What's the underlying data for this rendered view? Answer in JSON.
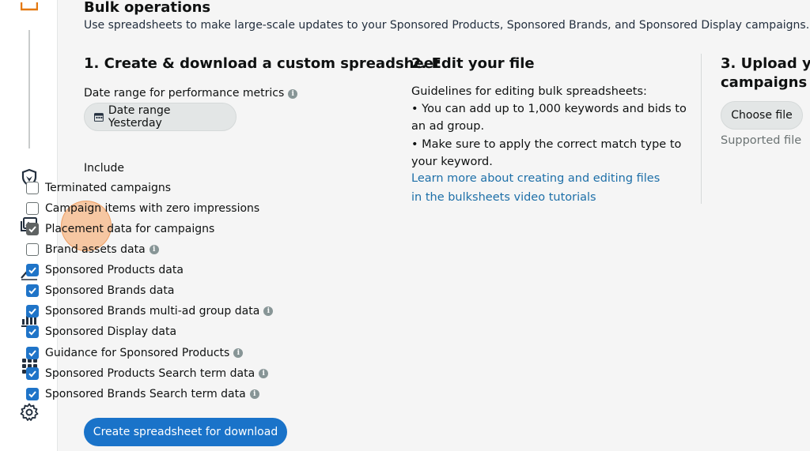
{
  "header": {
    "title": "Bulk operations",
    "subtitle": "Use spreadsheets to make large-scale updates to your Sponsored Products, Sponsored Brands, and Sponsored Display campaigns."
  },
  "step1": {
    "heading": "1. Create & download a custom spreadsheet",
    "date_label": "Date range for performance metrics",
    "date_button": "Date range Yesterday",
    "include_label": "Include",
    "options": [
      {
        "label": "Terminated campaigns",
        "checked": false,
        "info": false
      },
      {
        "label": "Campaign items with zero impressions",
        "checked": false,
        "info": false
      },
      {
        "label": "Placement data for campaigns",
        "checked": true,
        "info": false
      },
      {
        "label": "Brand assets data",
        "checked": false,
        "info": true
      },
      {
        "label": "Sponsored Products data",
        "checked": true,
        "info": false
      },
      {
        "label": "Sponsored Brands data",
        "checked": true,
        "info": false
      },
      {
        "label": "Sponsored Brands multi-ad group data",
        "checked": true,
        "info": true
      },
      {
        "label": "Sponsored Display data",
        "checked": true,
        "info": false
      },
      {
        "label": "Guidance for Sponsored Products",
        "checked": true,
        "info": true
      },
      {
        "label": "Sponsored Products Search term data",
        "checked": true,
        "info": true
      },
      {
        "label": "Sponsored Brands Search term data",
        "checked": true,
        "info": true
      }
    ],
    "create_button": "Create spreadsheet for download"
  },
  "step2": {
    "heading": "2. Edit your file",
    "guidelines_title": "Guidelines for editing bulk spreadsheets:",
    "bullet1_line1": "• You can add up to 1,000 keywords and bids to",
    "bullet1_line2": "an ad group.",
    "bullet2_line1": "• Make sure to apply the correct match type to",
    "bullet2_line2": "your keyword.",
    "link_line1": "Learn more about creating and editing files",
    "link_line2": "in the bulksheets video tutorials"
  },
  "step3": {
    "heading_line1": "3. Upload yo",
    "heading_line2": "campaigns",
    "choose_button": "Choose file",
    "supported": "Supported file"
  },
  "colors": {
    "accent": "#1a73c9",
    "link": "#1d6fa8",
    "highlight": "#f6a05c",
    "rail_icon": "#232f3e",
    "rail_active": "#e47911"
  },
  "rail": {
    "icons": [
      "campaigns-icon",
      "shield-icon",
      "media-library-icon",
      "trend-icon",
      "reports-icon",
      "apps-grid-icon",
      "settings-gear-icon"
    ]
  }
}
